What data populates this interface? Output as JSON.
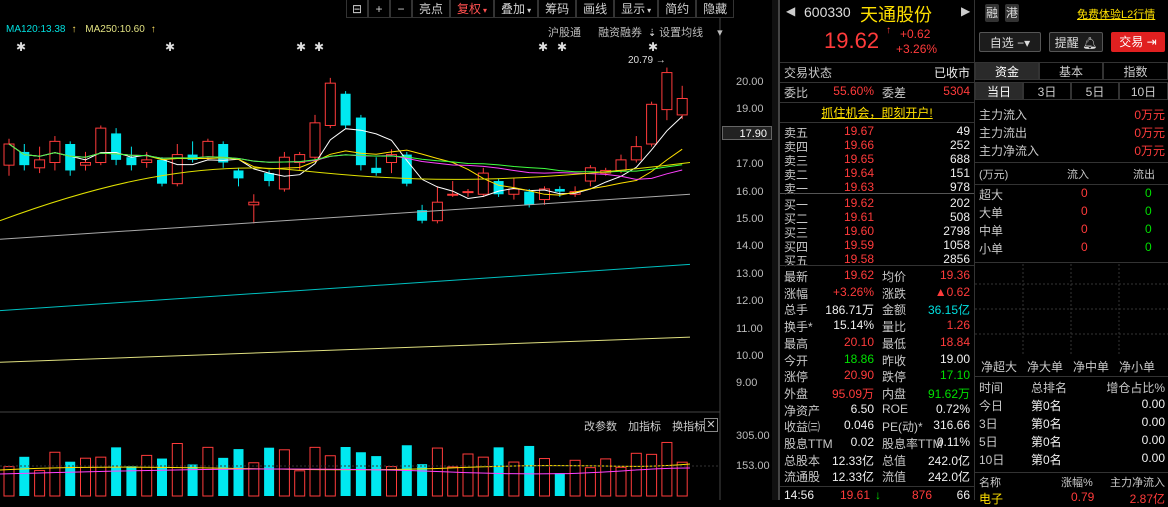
{
  "toolbar": {
    "items": [
      "亮点",
      "复权",
      "叠加",
      "筹码",
      "画线",
      "显示",
      "简约",
      "隐藏"
    ],
    "active": "复权"
  },
  "ma_legend": {
    "ma120": "MA120:13.38",
    "ma250": "MA250:10.60"
  },
  "sub_tabs": [
    "沪股通",
    "融资融券",
    "设置均线"
  ],
  "y_axis": [
    "20.00",
    "19.00",
    "18.00",
    "17.00",
    "16.00",
    "15.00",
    "14.00",
    "13.00",
    "12.00",
    "11.00",
    "10.00",
    "9.00"
  ],
  "current_price_tag": "17.90",
  "high_label": "20.79",
  "indicator_tabs": [
    "改参数",
    "加指标",
    "换指标"
  ],
  "volume_axis": [
    "305.00",
    "153.00"
  ],
  "chart_data": {
    "type": "candlestick",
    "candles": [
      {
        "o": 17.1,
        "c": 17.9,
        "h": 18.1,
        "l": 16.7
      },
      {
        "o": 17.6,
        "c": 17.1,
        "h": 17.9,
        "l": 16.9
      },
      {
        "o": 17.0,
        "c": 17.3,
        "h": 17.8,
        "l": 16.8
      },
      {
        "o": 17.2,
        "c": 18.0,
        "h": 18.2,
        "l": 16.9
      },
      {
        "o": 17.9,
        "c": 16.9,
        "h": 18.0,
        "l": 16.7
      },
      {
        "o": 17.1,
        "c": 17.2,
        "h": 17.6,
        "l": 16.9
      },
      {
        "o": 17.2,
        "c": 18.5,
        "h": 18.6,
        "l": 17.1
      },
      {
        "o": 18.3,
        "c": 17.3,
        "h": 18.5,
        "l": 17.1
      },
      {
        "o": 17.4,
        "c": 17.1,
        "h": 17.8,
        "l": 16.9
      },
      {
        "o": 17.2,
        "c": 17.3,
        "h": 17.6,
        "l": 17.0
      },
      {
        "o": 17.3,
        "c": 16.4,
        "h": 17.4,
        "l": 16.3
      },
      {
        "o": 16.4,
        "c": 17.5,
        "h": 17.9,
        "l": 16.3
      },
      {
        "o": 17.5,
        "c": 17.3,
        "h": 18.0,
        "l": 17.2
      },
      {
        "o": 17.4,
        "c": 18.0,
        "h": 18.1,
        "l": 17.3
      },
      {
        "o": 17.9,
        "c": 17.2,
        "h": 18.0,
        "l": 17.0
      },
      {
        "o": 16.9,
        "c": 16.6,
        "h": 17.0,
        "l": 16.3
      },
      {
        "o": 15.6,
        "c": 15.7,
        "h": 16.0,
        "l": 14.9
      },
      {
        "o": 16.8,
        "c": 16.5,
        "h": 16.9,
        "l": 16.3
      },
      {
        "o": 16.2,
        "c": 17.4,
        "h": 17.6,
        "l": 16.1
      },
      {
        "o": 17.2,
        "c": 17.5,
        "h": 17.6,
        "l": 16.9
      },
      {
        "o": 17.4,
        "c": 18.7,
        "h": 19.0,
        "l": 17.3
      },
      {
        "o": 18.6,
        "c": 20.2,
        "h": 20.4,
        "l": 18.5
      },
      {
        "o": 19.8,
        "c": 18.6,
        "h": 19.9,
        "l": 18.5
      },
      {
        "o": 18.9,
        "c": 17.1,
        "h": 19.0,
        "l": 16.9
      },
      {
        "o": 17.0,
        "c": 16.8,
        "h": 17.4,
        "l": 16.7
      },
      {
        "o": 17.2,
        "c": 17.5,
        "h": 17.7,
        "l": 16.8
      },
      {
        "o": 17.5,
        "c": 16.4,
        "h": 17.6,
        "l": 16.3
      },
      {
        "o": 15.4,
        "c": 15.0,
        "h": 15.6,
        "l": 14.9
      },
      {
        "o": 15.0,
        "c": 15.7,
        "h": 16.3,
        "l": 14.9
      },
      {
        "o": 16.0,
        "c": 16.0,
        "h": 16.5,
        "l": 15.9
      },
      {
        "o": 16.1,
        "c": 16.1,
        "h": 16.2,
        "l": 15.9
      },
      {
        "o": 16.0,
        "c": 16.8,
        "h": 17.0,
        "l": 15.9
      },
      {
        "o": 16.5,
        "c": 16.0,
        "h": 16.6,
        "l": 15.9
      },
      {
        "o": 16.0,
        "c": 16.2,
        "h": 16.6,
        "l": 15.8
      },
      {
        "o": 16.1,
        "c": 15.6,
        "h": 16.2,
        "l": 15.5
      },
      {
        "o": 15.8,
        "c": 16.2,
        "h": 16.3,
        "l": 15.6
      },
      {
        "o": 16.2,
        "c": 16.1,
        "h": 16.3,
        "l": 15.9
      },
      {
        "o": 16.0,
        "c": 16.1,
        "h": 16.3,
        "l": 15.9
      },
      {
        "o": 16.5,
        "c": 17.0,
        "h": 17.1,
        "l": 16.3
      },
      {
        "o": 16.8,
        "c": 16.9,
        "h": 17.0,
        "l": 16.7
      },
      {
        "o": 16.9,
        "c": 17.3,
        "h": 17.5,
        "l": 16.8
      },
      {
        "o": 17.3,
        "c": 17.8,
        "h": 18.2,
        "l": 17.2
      },
      {
        "o": 17.9,
        "c": 19.4,
        "h": 19.5,
        "l": 17.8
      },
      {
        "o": 19.2,
        "c": 20.6,
        "h": 20.79,
        "l": 18.8
      },
      {
        "o": 19.0,
        "c": 19.62,
        "h": 20.1,
        "l": 18.84
      }
    ],
    "ma_lines": [
      "MA120",
      "MA250"
    ],
    "ylim": [
      8.6,
      21.0
    ]
  },
  "quote": {
    "code": "600330",
    "name": "天通股份",
    "tag1": "融",
    "tag2": "港",
    "l2_link": "免费体验L2行情",
    "price": "19.62",
    "change": "+0.62",
    "change_pct": "+3.26%",
    "btn_watch": "自选",
    "btn_alert": "提醒",
    "btn_trade": "交易",
    "status_label": "交易状态",
    "status_value": "已收市",
    "weibi_label": "委比",
    "weibi_value": "55.60%",
    "weicha_label": "委差",
    "weicha_value": "5304",
    "promo": "抓住机会，即刻开户!",
    "asks": [
      {
        "label": "卖五",
        "price": "19.67",
        "vol": "49"
      },
      {
        "label": "卖四",
        "price": "19.66",
        "vol": "252"
      },
      {
        "label": "卖三",
        "price": "19.65",
        "vol": "688"
      },
      {
        "label": "卖二",
        "price": "19.64",
        "vol": "151"
      },
      {
        "label": "卖一",
        "price": "19.63",
        "vol": "978"
      }
    ],
    "bids": [
      {
        "label": "买一",
        "price": "19.62",
        "vol": "202"
      },
      {
        "label": "买二",
        "price": "19.61",
        "vol": "508"
      },
      {
        "label": "买三",
        "price": "19.60",
        "vol": "2798"
      },
      {
        "label": "买四",
        "price": "19.59",
        "vol": "1058"
      },
      {
        "label": "买五",
        "price": "19.58",
        "vol": "2856"
      }
    ],
    "stats": [
      {
        "a": "最新",
        "av": "19.62",
        "ac": "red",
        "b": "均价",
        "bv": "19.36",
        "bc": "red"
      },
      {
        "a": "涨幅",
        "av": "+3.26%",
        "ac": "red",
        "b": "涨跌",
        "bv": "▲0.62",
        "bc": "red"
      },
      {
        "a": "总手",
        "av": "186.71万",
        "ac": "white",
        "b": "金额",
        "bv": "36.15亿",
        "bc": "cyan"
      },
      {
        "a": "换手*",
        "av": "15.14%",
        "ac": "white",
        "b": "量比",
        "bv": "1.26",
        "bc": "red"
      },
      {
        "a": "最高",
        "av": "20.10",
        "ac": "red",
        "b": "最低",
        "bv": "18.84",
        "bc": "red"
      },
      {
        "a": "今开",
        "av": "18.86",
        "ac": "green",
        "b": "昨收",
        "bv": "19.00",
        "bc": "white"
      },
      {
        "a": "涨停",
        "av": "20.90",
        "ac": "red",
        "b": "跌停",
        "bv": "17.10",
        "bc": "green"
      },
      {
        "a": "外盘",
        "av": "95.09万",
        "ac": "red",
        "b": "内盘",
        "bv": "91.62万",
        "bc": "green"
      },
      {
        "a": "净资产",
        "av": "6.50",
        "ac": "white",
        "b": "ROE",
        "bv": "0.72%",
        "bc": "white"
      },
      {
        "a": "收益㈢",
        "av": "0.046",
        "ac": "white",
        "b": "PE(动)*",
        "bv": "316.66",
        "bc": "white"
      },
      {
        "a": "股息TTM",
        "av": "0.02",
        "ac": "white",
        "b": "股息率TTM",
        "bv": "0.11%",
        "bc": "white"
      },
      {
        "a": "总股本",
        "av": "12.33亿",
        "ac": "white",
        "b": "总值",
        "bv": "242.0亿",
        "bc": "white"
      },
      {
        "a": "流通股",
        "av": "12.33亿",
        "ac": "white",
        "b": "流值",
        "bv": "242.0亿",
        "bc": "white"
      }
    ],
    "tick": {
      "time": "14:56",
      "price": "19.61",
      "vol": "876",
      "extra": "66"
    }
  },
  "funds": {
    "tabs": [
      "资金",
      "基本",
      "指数"
    ],
    "periods": [
      "当日",
      "3日",
      "5日",
      "10日"
    ],
    "flows": [
      {
        "label": "主力流入",
        "value": "0万元"
      },
      {
        "label": "主力流出",
        "value": "0万元"
      },
      {
        "label": "主力净流入",
        "value": "0万元"
      }
    ],
    "table_header": {
      "unit": "(万元)",
      "in": "流入",
      "out": "流出"
    },
    "table_rows": [
      {
        "label": "超大",
        "in": "0",
        "out": "0"
      },
      {
        "label": "大单",
        "in": "0",
        "out": "0"
      },
      {
        "label": "中单",
        "in": "0",
        "out": "0"
      },
      {
        "label": "小单",
        "in": "0",
        "out": "0"
      }
    ],
    "net_labels": [
      "净超大",
      "净大单",
      "净中单",
      "净小单"
    ],
    "rank_header": {
      "time": "时间",
      "rank": "总排名",
      "add": "增仓占比%"
    },
    "rank_rows": [
      {
        "t": "今日",
        "r": "第0名",
        "v": "0.00"
      },
      {
        "t": "3日",
        "r": "第0名",
        "v": "0.00"
      },
      {
        "t": "5日",
        "r": "第0名",
        "v": "0.00"
      },
      {
        "t": "10日",
        "r": "第0名",
        "v": "0.00"
      }
    ],
    "bottom_header": {
      "name": "名称",
      "pct": "涨幅%",
      "net": "主力净流入"
    },
    "bottom_row": {
      "name": "电子",
      "pct": "0.79",
      "net": "2.87亿"
    }
  }
}
